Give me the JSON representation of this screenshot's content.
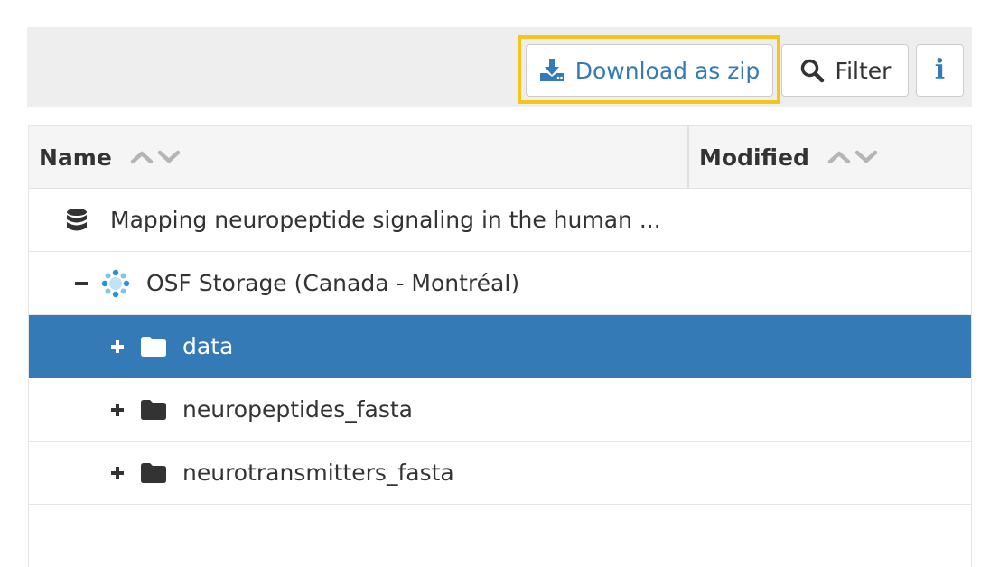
{
  "toolbar": {
    "download_zip_label": "Download as zip",
    "filter_label": "Filter",
    "info_label": "i",
    "icons": {
      "download": "download-icon",
      "filter": "search-icon",
      "info": "info-icon"
    }
  },
  "grid": {
    "columns": [
      {
        "label": "Name"
      },
      {
        "label": "Modified"
      }
    ],
    "rows": [
      {
        "name": "Mapping neuropeptide signaling in the human ...",
        "icon": "database-icon",
        "toggle": ""
      },
      {
        "name": "OSF Storage (Canada - Montréal)",
        "icon": "storage-provider-icon",
        "toggle": "collapse"
      },
      {
        "name": "data",
        "icon": "folder-icon",
        "toggle": "expand",
        "selected": true
      },
      {
        "name": "neuropeptides_fasta",
        "icon": "folder-icon",
        "toggle": "expand"
      },
      {
        "name": "neurotransmitters_fasta",
        "icon": "folder-icon",
        "toggle": "expand"
      }
    ]
  },
  "colors": {
    "accent": "#337ab7",
    "highlight": "#f5c518",
    "toolbar_bg": "#eeeeee",
    "header_bg": "#f5f5f5"
  }
}
